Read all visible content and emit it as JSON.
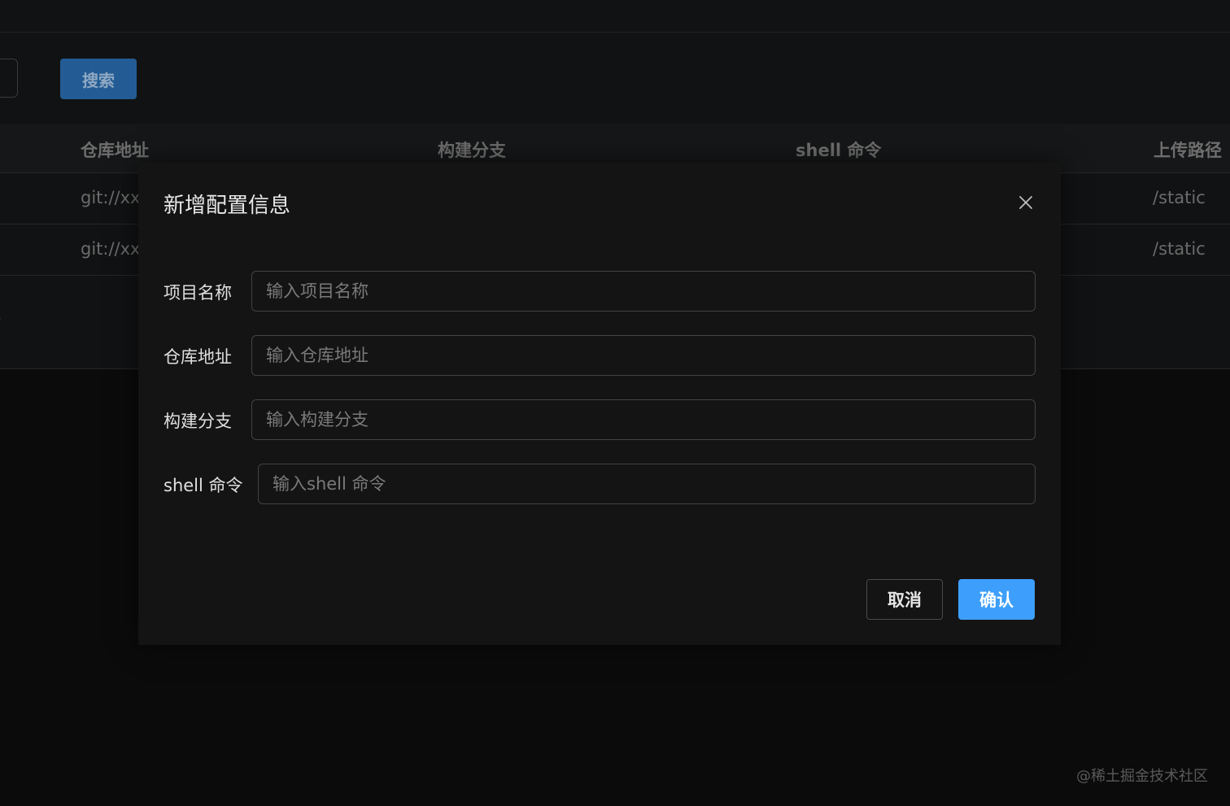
{
  "toolbar": {
    "search_label": "搜索"
  },
  "table": {
    "columns": [
      "仓库地址",
      "构建分支",
      "shell 命令",
      "上传路径"
    ],
    "rows": [
      {
        "repo": "git://xx:",
        "path": "/static"
      },
      {
        "repo": "git://xx:",
        "path": "/static"
      }
    ]
  },
  "dialog": {
    "title": "新增配置信息",
    "fields": [
      {
        "label": "项目名称",
        "placeholder": "输入项目名称",
        "value": ""
      },
      {
        "label": "仓库地址",
        "placeholder": "输入仓库地址",
        "value": ""
      },
      {
        "label": "构建分支",
        "placeholder": "输入构建分支",
        "value": ""
      },
      {
        "label": "shell 命令",
        "placeholder": "输入shell 命令",
        "value": ""
      }
    ],
    "cancel_label": "取消",
    "ok_label": "确认"
  },
  "watermark": "@稀土掘金技术社区",
  "colors": {
    "primary": "#3d9ffb",
    "search_button": "#235c94",
    "dialog_bg": "#141414",
    "page_bg": "#0b0b0b"
  },
  "icons": {
    "close": "close-icon",
    "pager": "chevron-right-icon"
  }
}
